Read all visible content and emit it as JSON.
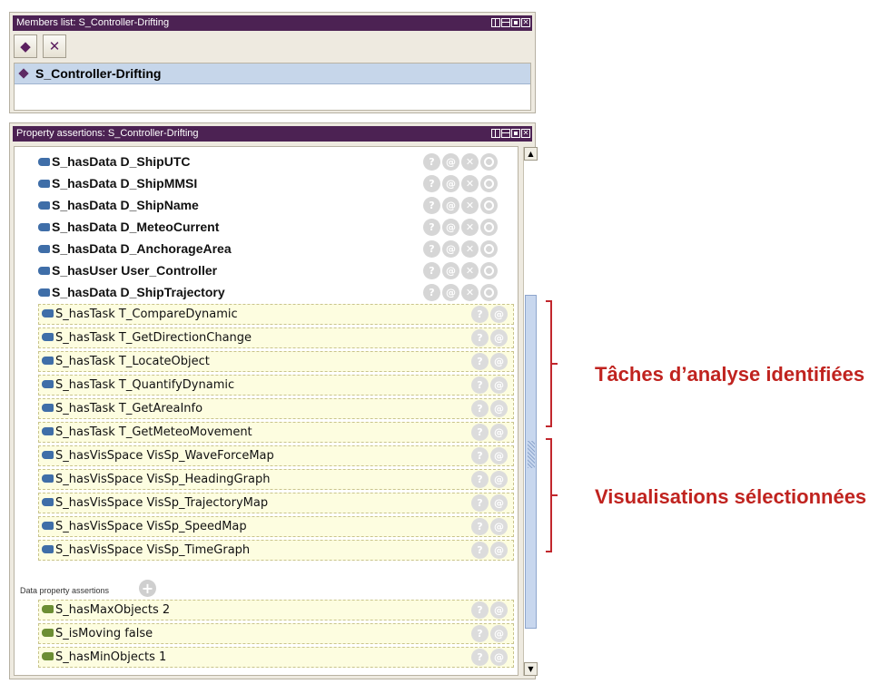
{
  "members_panel": {
    "title": "Members list: S_Controller-Drifting",
    "toolbar": {
      "add_icon_glyph": "◆",
      "delete_icon_glyph": "✕"
    },
    "selected_member": "S_Controller-Drifting"
  },
  "assertions_panel": {
    "title": "Property assertions: S_Controller-Drifting",
    "object_assertions": [
      {
        "label": "S_hasData  D_ShipUTC"
      },
      {
        "label": "S_hasData  D_ShipMMSI"
      },
      {
        "label": "S_hasData  D_ShipName"
      },
      {
        "label": "S_hasData  D_MeteoCurrent"
      },
      {
        "label": "S_hasData  D_AnchorageArea"
      },
      {
        "label": "S_hasUser  User_Controller"
      },
      {
        "label": "S_hasData  D_ShipTrajectory"
      }
    ],
    "task_assertions": [
      {
        "label": "S_hasTask  T_CompareDynamic"
      },
      {
        "label": "S_hasTask  T_GetDirectionChange"
      },
      {
        "label": "S_hasTask  T_LocateObject"
      },
      {
        "label": "S_hasTask  T_QuantifyDynamic"
      },
      {
        "label": "S_hasTask  T_GetAreaInfo"
      },
      {
        "label": "S_hasTask  T_GetMeteoMovement"
      }
    ],
    "vis_assertions": [
      {
        "label": "S_hasVisSpace  VisSp_WaveForceMap"
      },
      {
        "label": "S_hasVisSpace  VisSp_HeadingGraph"
      },
      {
        "label": "S_hasVisSpace  VisSp_TrajectoryMap"
      },
      {
        "label": "S_hasVisSpace  VisSp_SpeedMap"
      },
      {
        "label": "S_hasVisSpace  VisSp_TimeGraph"
      }
    ],
    "data_section_label": "Data property assertions",
    "data_assertions": [
      {
        "label": "S_hasMaxObjects  2"
      },
      {
        "label": "S_isMoving  false"
      },
      {
        "label": "S_hasMinObjects  1"
      }
    ],
    "row_buttons": {
      "explain": "?",
      "annotate": "@",
      "delete": "✕"
    }
  },
  "annotations": {
    "tasks": "Tâches d’analyse identifiées",
    "visualisations": "Visualisations sélectionnées"
  },
  "colors": {
    "titlebar": "#4c2253",
    "annotation_red": "#c0231f",
    "inferred_row_bg": "#fdfde0",
    "object_property_bullet": "#3f6ea8",
    "data_property_bullet": "#6c8e34"
  }
}
